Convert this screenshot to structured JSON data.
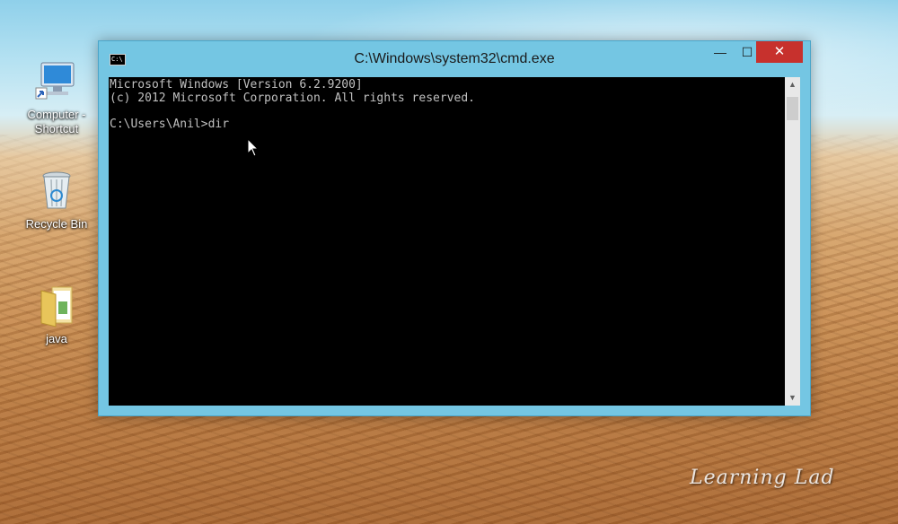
{
  "desktop": {
    "icons": [
      {
        "label_line1": "Computer -",
        "label_line2": "Shortcut",
        "icon": "computer-icon"
      },
      {
        "label": "Recycle Bin",
        "icon": "recycle-bin-icon"
      },
      {
        "label": "java",
        "icon": "folder-icon"
      }
    ],
    "watermark": "Learning Lad"
  },
  "window": {
    "title": "C:\\Windows\\system32\\cmd.exe",
    "app_icon_text": "C:\\",
    "controls": {
      "minimize": "—",
      "maximize": "☐",
      "close": "✕"
    }
  },
  "console": {
    "lines": [
      "Microsoft Windows [Version 6.2.9200]",
      "(c) 2012 Microsoft Corporation. All rights reserved.",
      "",
      "C:\\Users\\Anil>dir"
    ]
  },
  "colors": {
    "titlebar": "#74c6e3",
    "close": "#c7312d",
    "console_bg": "#000000",
    "console_fg": "#c0c0c0"
  }
}
